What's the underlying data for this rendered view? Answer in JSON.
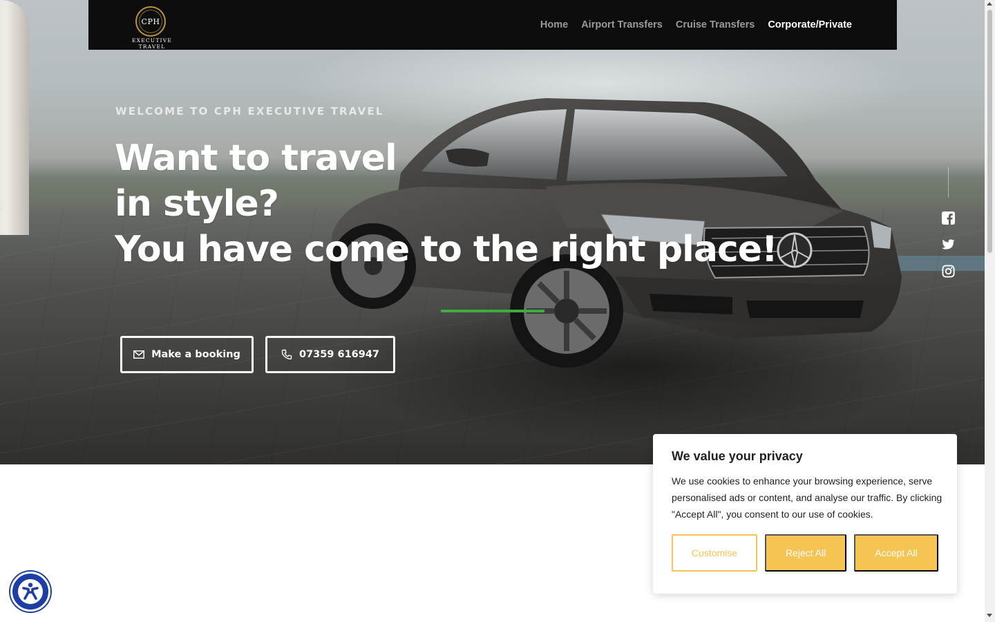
{
  "brand": {
    "monogram": "CPH",
    "tagline": "EXECUTIVE TRAVEL",
    "gold": "#b8933f"
  },
  "nav": {
    "items": [
      {
        "label": "Home",
        "active": false
      },
      {
        "label": "Airport Transfers",
        "active": false
      },
      {
        "label": "Cruise Transfers",
        "active": false
      },
      {
        "label": "Corporate/Private",
        "active": true
      }
    ]
  },
  "hero": {
    "eyebrow": "WELCOME TO CPH EXECUTIVE TRAVEL",
    "headline": [
      "Want to travel",
      "in style?",
      "You have come to the right place!"
    ],
    "accent_color": "#3cae3f",
    "buttons": {
      "booking": {
        "label": "Make a booking",
        "icon": "mail-icon"
      },
      "phone": {
        "label": "07359 616947",
        "icon": "phone-icon"
      }
    }
  },
  "social": [
    "facebook-icon",
    "twitter-icon",
    "instagram-icon"
  ],
  "cookie_banner": {
    "title": "We value your privacy",
    "text": "We use cookies to enhance your browsing experience, serve personalised ads or content, and analyse our traffic. By clicking \"Accept All\", you consent to our use of cookies.",
    "buttons": {
      "customise": "Customise",
      "reject": "Reject All",
      "accept": "Accept All"
    },
    "button_color": "#f6c453"
  },
  "accessibility": {
    "icon": "accessibility-icon",
    "color": "#1d3fa3"
  }
}
